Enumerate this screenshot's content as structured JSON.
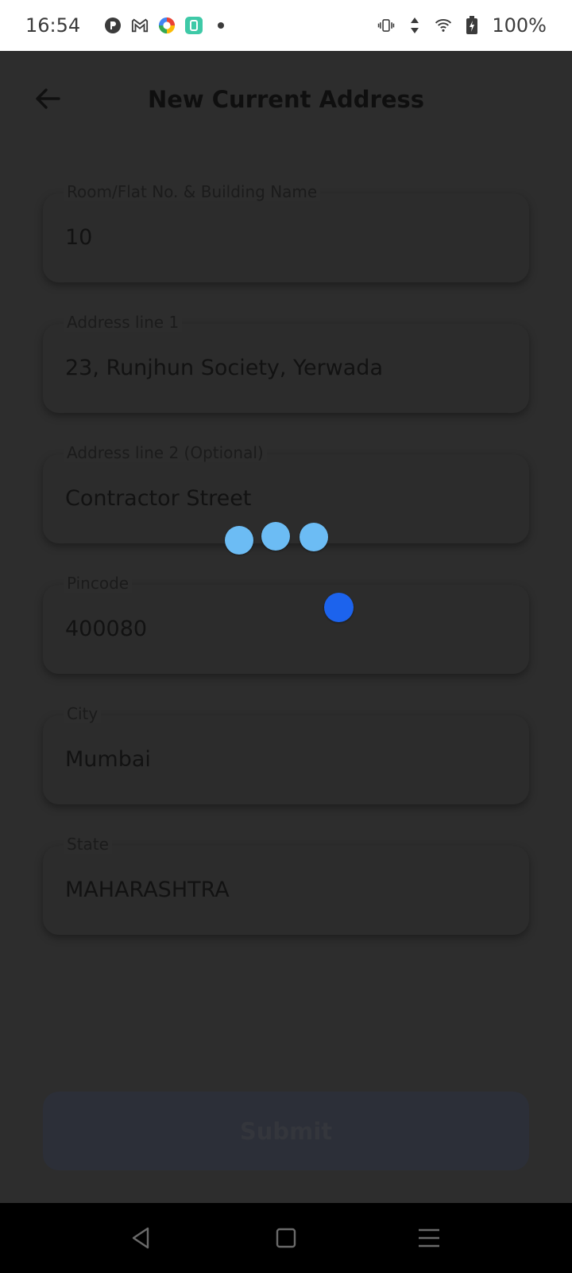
{
  "status_bar": {
    "time": "16:54",
    "battery_percent": "100%",
    "left_icons": [
      "data-saver-icon",
      "gmail-icon",
      "colorful-app-icon",
      "green-app-icon",
      "dot-icon"
    ],
    "right_icons": [
      "vibrate-icon",
      "data-arrows-icon",
      "wifi-icon",
      "battery-charging-icon"
    ]
  },
  "header": {
    "title": "New Current Address",
    "back_icon": "arrow-left-icon"
  },
  "form": {
    "fields": [
      {
        "label": "Room/Flat No. & Building Name",
        "value": "10"
      },
      {
        "label": "Address line 1",
        "value": "23, Runjhun Society, Yerwada"
      },
      {
        "label": "Address line 2 (Optional)",
        "value": "Contractor Street"
      },
      {
        "label": "Pincode",
        "value": "400080"
      },
      {
        "label": "City",
        "value": "Mumbai"
      },
      {
        "label": "State",
        "value": "MAHARASHTRA"
      }
    ],
    "submit_label": "Submit"
  },
  "loader": {
    "dot_color": "#6cbcf4",
    "accent_dot_color": "#1c63ed"
  },
  "nav_bar": {
    "icons": [
      "back-triangle-icon",
      "home-square-icon",
      "menu-lines-icon"
    ]
  },
  "colors": {
    "overlay_background": "#2d2d2d",
    "status_bar_background": "#ffffff",
    "nav_bar_background": "#000000"
  }
}
